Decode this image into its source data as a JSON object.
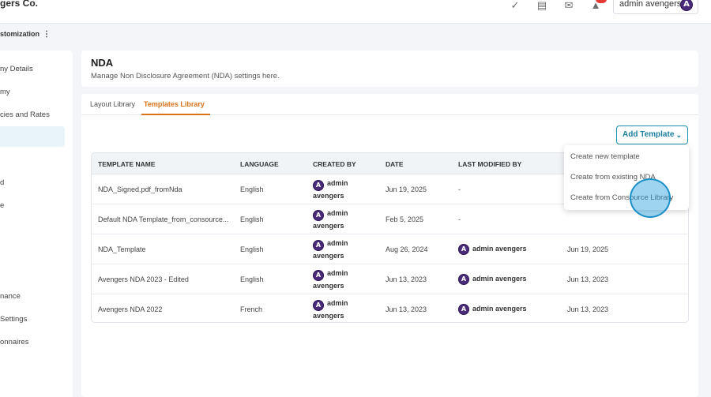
{
  "header": {
    "brand": "gers Co.",
    "icons": [
      "check-circle-icon",
      "document-icon",
      "mail-icon",
      "bell-icon"
    ],
    "user_name": "admin avengers"
  },
  "subheader": {
    "title": "stomization",
    "menu_icon": "⋮"
  },
  "sidebar": {
    "items": [
      {
        "label": "ny Details"
      },
      {
        "label": "my"
      },
      {
        "label": "cies and Rates"
      },
      {
        "label": ""
      },
      {
        "label": "d"
      },
      {
        "label": "e"
      },
      {
        "label": "nance"
      },
      {
        "label": "Settings"
      },
      {
        "label": "onnaires"
      }
    ]
  },
  "page": {
    "title": "NDA",
    "subtitle": "Manage Non Disclosure Agreement (NDA) settings here."
  },
  "tabs": [
    {
      "label": "Layout Library",
      "active": false
    },
    {
      "label": "Templates Library",
      "active": true
    }
  ],
  "add_button": {
    "label": "Add Template"
  },
  "dropdown": {
    "items": [
      "Create new template",
      "Create from existing NDA",
      "Create from Consource Library"
    ]
  },
  "table": {
    "columns": [
      "TEMPLATE NAME",
      "LANGUAGE",
      "CREATED BY",
      "DATE",
      "LAST MODIFIED BY",
      ""
    ],
    "rows": [
      {
        "name": "NDA_Signed.pdf_fromNda",
        "language": "English",
        "created_by_1": "admin",
        "created_by_2": "avengers",
        "date": "Jun 19, 2025",
        "modified_by": "-",
        "modified_date": ""
      },
      {
        "name": "Default NDA Template_from_consource...",
        "language": "English",
        "created_by_1": "admin",
        "created_by_2": "avengers",
        "date": "Feb 5, 2025",
        "modified_by": "-",
        "modified_date": ""
      },
      {
        "name": "NDA_Template",
        "language": "English",
        "created_by_1": "admin",
        "created_by_2": "avengers",
        "date": "Aug 26, 2024",
        "modified_by": "admin avengers",
        "modified_date": "Jun 19, 2025"
      },
      {
        "name": "Avengers NDA 2023 - Edited",
        "language": "English",
        "created_by_1": "admin",
        "created_by_2": "avengers",
        "date": "Jun 13, 2023",
        "modified_by": "admin avengers",
        "modified_date": "Jun 13, 2023"
      },
      {
        "name": "Avengers NDA 2022",
        "language": "French",
        "created_by_1": "admin",
        "created_by_2": "avengers",
        "date": "Jun 13, 2023",
        "modified_by": "admin avengers",
        "modified_date": "Jun 13, 2023"
      }
    ]
  },
  "colors": {
    "accent": "#d9731a",
    "primary": "#1b8fb0"
  }
}
